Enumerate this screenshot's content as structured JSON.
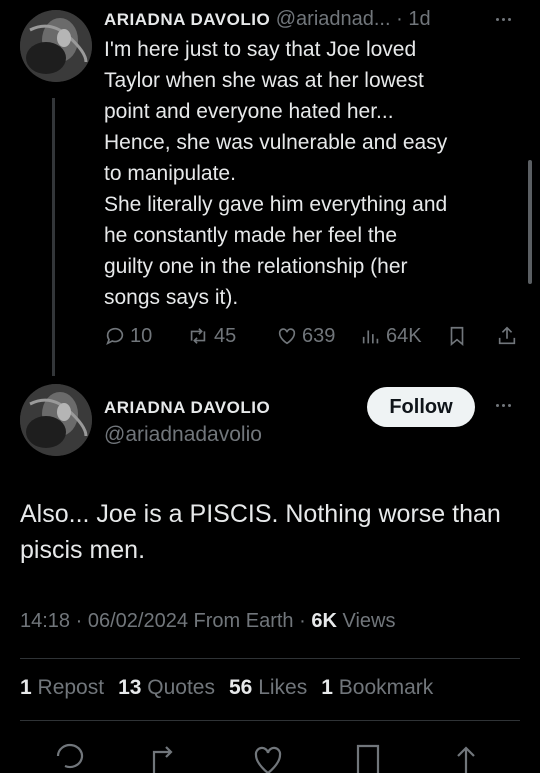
{
  "reply_tweet": {
    "display_name": "ARIADNA DAVOLIO",
    "handle_truncated": "@ariadnad...",
    "separator": "·",
    "time_ago": "1d",
    "text": "I'm here just to say that Joe loved\nTaylor when she was at her lowest\npoint and everyone hated her...\nHence, she was vulnerable and easy\nto manipulate.\nShe literally gave him everything and\nhe constantly made her feel the\nguilty one in the relationship (her\nsongs says it).",
    "actions": {
      "replies": "10",
      "reposts": "45",
      "likes": "639",
      "views": "64K"
    }
  },
  "main_tweet": {
    "display_name": "ARIADNA DAVOLIO",
    "handle": "@ariadnadavolio",
    "follow_label": "Follow",
    "text": "Also... Joe is a PISCIS. Nothing worse than piscis men.",
    "meta": {
      "time": "14:18",
      "date": "06/02/2024",
      "source": "From Earth",
      "views_count": "6K",
      "views_label": "Views"
    },
    "stats": {
      "reposts_count": "1",
      "reposts_label": "Repost",
      "quotes_count": "13",
      "quotes_label": "Quotes",
      "likes_count": "56",
      "likes_label": "Likes",
      "bookmarks_count": "1",
      "bookmarks_label": "Bookmark"
    }
  },
  "icons": {
    "reply": "reply-icon",
    "repost": "repost-icon",
    "like": "heart-icon",
    "views": "views-icon",
    "bookmark": "bookmark-icon",
    "share": "share-icon",
    "more": "more-icon"
  },
  "colors": {
    "background": "#000000",
    "text": "#e7e9ea",
    "muted": "#71767b",
    "follow_bg": "#eff3f4",
    "divider": "#2f3336"
  }
}
